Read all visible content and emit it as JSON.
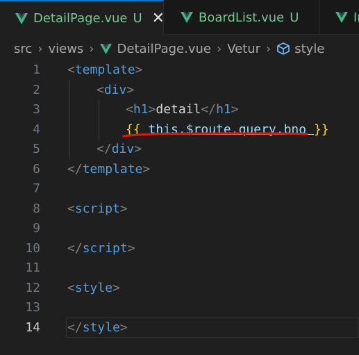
{
  "tabs": [
    {
      "name": "DetailPage.vue",
      "status": "U",
      "active": true,
      "close": "✕"
    },
    {
      "name": "BoardList.vue",
      "status": "U",
      "active": false
    },
    {
      "name": "In",
      "status": "",
      "active": false
    }
  ],
  "breadcrumb": {
    "items": [
      "src",
      "views",
      "DetailPage.vue",
      "Vetur",
      "style"
    ],
    "separator": "›"
  },
  "editor": {
    "current_line": "14",
    "lines": [
      {
        "n": "1",
        "tokens": [
          "<",
          "template",
          ">"
        ]
      },
      {
        "n": "2",
        "tokens": [
          "<",
          "div",
          ">"
        ]
      },
      {
        "n": "3",
        "tokens": [
          "<",
          "h1",
          ">",
          "detail",
          "</",
          "h1",
          ">"
        ]
      },
      {
        "n": "4",
        "tokens": [
          "{{",
          " this.$route.query.bno ",
          "}}"
        ]
      },
      {
        "n": "5",
        "tokens": [
          "</",
          "div",
          ">"
        ]
      },
      {
        "n": "6",
        "tokens": [
          "</",
          "template",
          ">"
        ]
      },
      {
        "n": "7",
        "tokens": []
      },
      {
        "n": "8",
        "tokens": [
          "<",
          "script",
          ">"
        ]
      },
      {
        "n": "9",
        "tokens": []
      },
      {
        "n": "10",
        "tokens": [
          "</",
          "script",
          ">"
        ]
      },
      {
        "n": "11",
        "tokens": []
      },
      {
        "n": "12",
        "tokens": [
          "<",
          "style",
          ">"
        ]
      },
      {
        "n": "13",
        "tokens": []
      },
      {
        "n": "14",
        "tokens": [
          "</",
          "style",
          ">"
        ]
      }
    ]
  },
  "colors": {
    "tag": "#569cd6",
    "punctuation": "#808080",
    "text": "#d4d4d4",
    "interpolation_brace": "#ffd700",
    "expression": "#9cdcfe",
    "vue_icon": "#41b883",
    "untracked": "#73c991",
    "annotation": "#e51400"
  },
  "icons": {
    "tab_file": "vue-icon",
    "breadcrumb_file": "vue-icon",
    "breadcrumb_symbol": "cube-icon"
  }
}
